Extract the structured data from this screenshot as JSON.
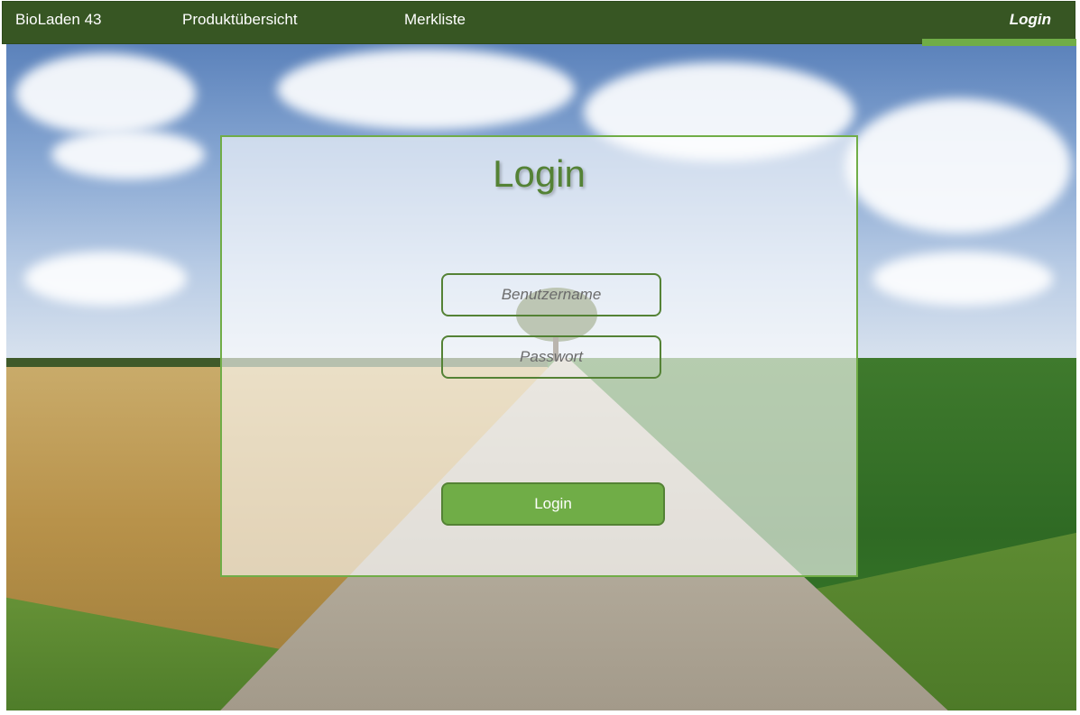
{
  "nav": {
    "brand": "BioLaden 43",
    "products": "Produktübersicht",
    "wishlist": "Merkliste",
    "login": "Login"
  },
  "login_form": {
    "title": "Login",
    "username_placeholder": "Benutzername",
    "password_placeholder": "Passwort",
    "submit_label": "Login"
  },
  "colors": {
    "nav_background": "#375623",
    "accent": "#70ad47",
    "title_green": "#548235"
  }
}
